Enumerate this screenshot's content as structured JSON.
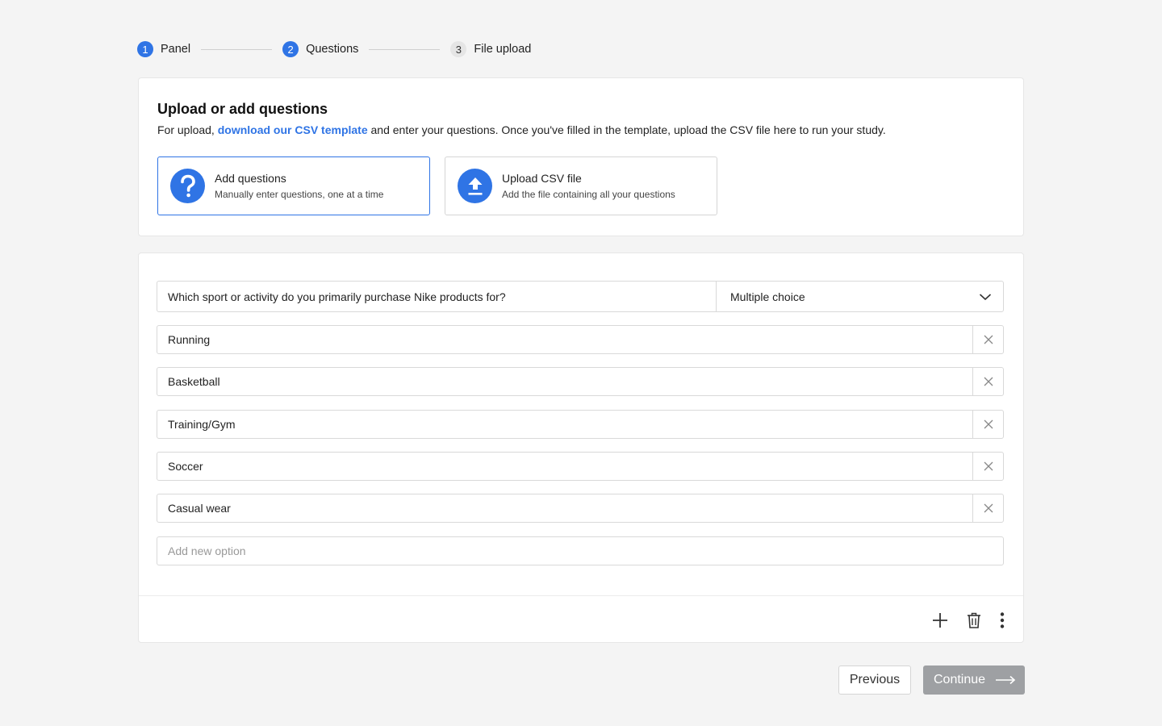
{
  "stepper": {
    "steps": [
      {
        "number": "1",
        "label": "Panel",
        "state": "active"
      },
      {
        "number": "2",
        "label": "Questions",
        "state": "active"
      },
      {
        "number": "3",
        "label": "File upload",
        "state": "inactive"
      }
    ]
  },
  "upload_card": {
    "title": "Upload or add questions",
    "desc_prefix": "For upload, ",
    "desc_link": "download our CSV template",
    "desc_suffix": " and enter your questions. Once you've filled in the template, upload the CSV file here to run your study.",
    "choices": [
      {
        "title": "Add questions",
        "subtitle": "Manually enter questions, one at a time",
        "icon": "question-icon",
        "selected": true
      },
      {
        "title": "Upload CSV file",
        "subtitle": "Add the file containing all your questions",
        "icon": "upload-icon",
        "selected": false
      }
    ]
  },
  "question": {
    "text": "Which sport or activity do you primarily purchase Nike products for?",
    "type": "Multiple choice",
    "options": [
      "Running",
      "Basketball",
      "Training/Gym",
      "Soccer",
      "Casual wear"
    ],
    "new_option_placeholder": "Add new option"
  },
  "footer": {
    "previous_label": "Previous",
    "continue_label": "Continue"
  },
  "colors": {
    "accent": "#2f74e5",
    "continue_disabled": "#9ea0a3",
    "background": "#f4f4f4"
  }
}
